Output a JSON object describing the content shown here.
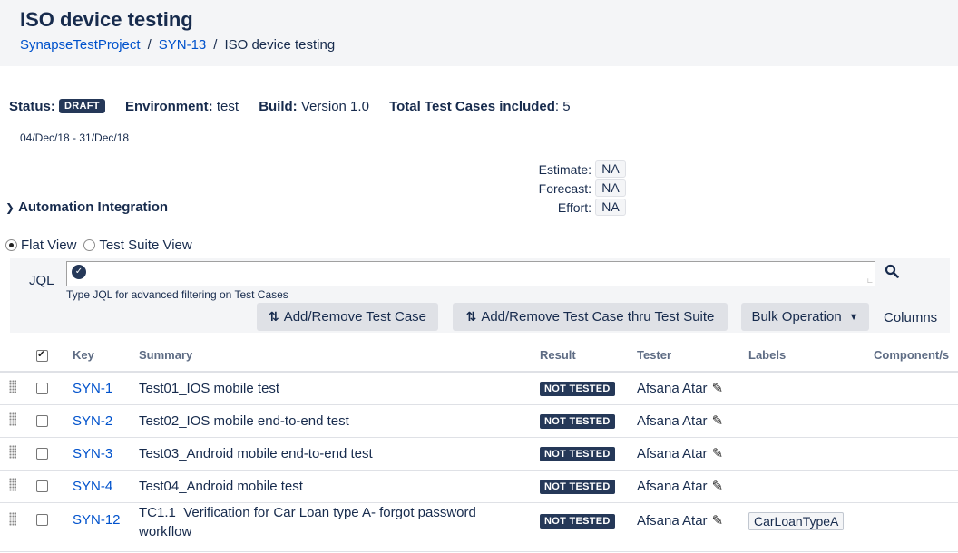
{
  "header": {
    "title": "ISO device testing",
    "breadcrumb": [
      "SynapseTestProject",
      "SYN-13",
      "ISO device testing"
    ]
  },
  "status": {
    "status_label": "Status:",
    "status_value": "DRAFT",
    "environment_label": "Environment:",
    "environment_value": "test",
    "build_label": "Build:",
    "build_value": "Version 1.0",
    "total_label": "Total Test Cases included",
    "total_value": ": 5",
    "date_range": "04/Dec/18 - 31/Dec/18"
  },
  "metrics": [
    {
      "label": "Estimate:",
      "value": "NA"
    },
    {
      "label": "Forecast:",
      "value": "NA"
    },
    {
      "label": "Effort:",
      "value": "NA"
    }
  ],
  "automation": {
    "label": "Automation Integration"
  },
  "view": {
    "flat": "Flat View",
    "suite": "Test Suite View",
    "selected": "flat"
  },
  "jql": {
    "label": "JQL",
    "hint": "Type JQL for advanced filtering on Test Cases"
  },
  "toolbar": {
    "add_remove": "Add/Remove Test Case",
    "add_remove_suite": "Add/Remove Test Case thru Test Suite",
    "bulk": "Bulk Operation",
    "columns": "Columns"
  },
  "table": {
    "headers": {
      "key": "Key",
      "summary": "Summary",
      "result": "Result",
      "tester": "Tester",
      "labels": "Labels",
      "components": "Component/s"
    },
    "rows": [
      {
        "key": "SYN-1",
        "summary": "Test01_IOS mobile test",
        "result": "NOT TESTED",
        "tester": "Afsana Atar",
        "label": ""
      },
      {
        "key": "SYN-2",
        "summary": "Test02_IOS mobile end-to-end test",
        "result": "NOT TESTED",
        "tester": "Afsana Atar",
        "label": ""
      },
      {
        "key": "SYN-3",
        "summary": "Test03_Android mobile end-to-end test",
        "result": "NOT TESTED",
        "tester": "Afsana Atar",
        "label": ""
      },
      {
        "key": "SYN-4",
        "summary": "Test04_Android mobile test",
        "result": "NOT TESTED",
        "tester": "Afsana Atar",
        "label": ""
      },
      {
        "key": "SYN-12",
        "summary": "TC1.1_Verification for Car Loan type A- forgot password workflow",
        "result": "NOT TESTED",
        "tester": "Afsana Atar",
        "label": "CarLoanTypeA"
      }
    ]
  }
}
